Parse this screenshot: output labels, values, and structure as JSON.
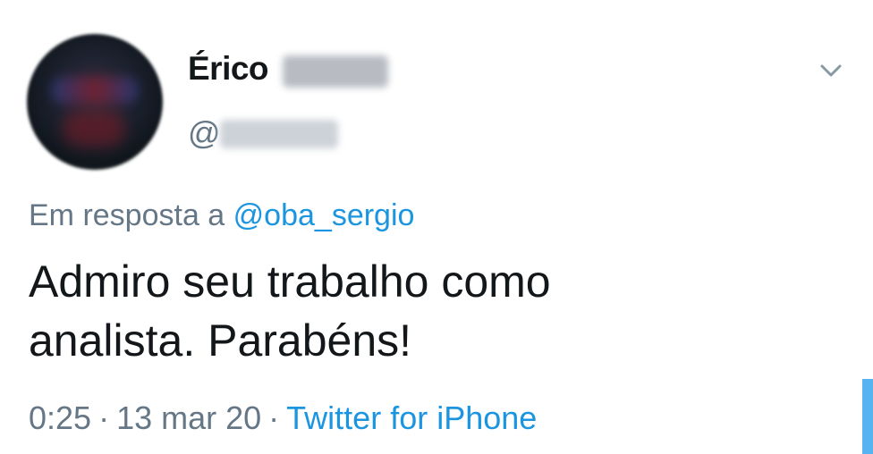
{
  "tweet": {
    "author": {
      "display_name": "Érico",
      "handle_prefix": "@"
    },
    "reply": {
      "prefix": "Em resposta a",
      "mention": "@oba_sergio"
    },
    "text_line1": "Admiro seu trabalho como",
    "text_line2": "analista. Parabéns!",
    "meta": {
      "time": "0:25",
      "separator": "·",
      "date": "13 mar 20",
      "source": "Twitter for iPhone"
    },
    "menu_icon": "chevron-down-icon"
  },
  "colors": {
    "text": "#14171a",
    "muted": "#657786",
    "link": "#1b95e0",
    "edge_accent": "#58b4f0"
  }
}
